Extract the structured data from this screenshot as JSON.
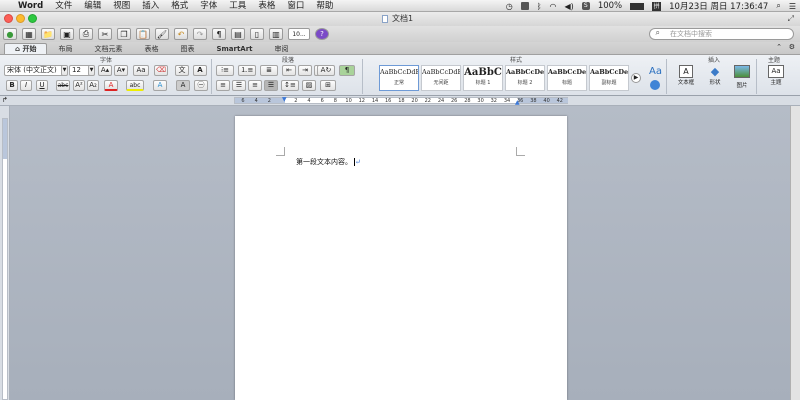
{
  "menubar": {
    "apple": "",
    "app": "Word",
    "items": [
      "文件",
      "编辑",
      "视图",
      "插入",
      "格式",
      "字体",
      "工具",
      "表格",
      "窗口",
      "帮助"
    ],
    "battery": "100%",
    "datetime": "10月23日 周日 17:36:47"
  },
  "window": {
    "title": "文档1"
  },
  "toolbar": {
    "zoom": "10...",
    "search_placeholder": "在文档中搜索"
  },
  "tabs": [
    "开始",
    "布局",
    "文档元素",
    "表格",
    "图表",
    "SmartArt",
    "审阅"
  ],
  "ribbon": {
    "groups": {
      "font": "字体",
      "paragraph": "段落",
      "styles": "样式",
      "insert": "插入",
      "themes": "主题"
    },
    "font_name": "宋体 (中文正文)",
    "font_size": "12",
    "styles": [
      {
        "preview": "AaBbCcDdEe",
        "name": "正常"
      },
      {
        "preview": "AaBbCcDdEe",
        "name": "无间距"
      },
      {
        "preview": "AaBbC",
        "name": "标题 1"
      },
      {
        "preview": "AaBbCcDe",
        "name": "标题 2"
      },
      {
        "preview": "AaBbCcDe",
        "name": "标题"
      },
      {
        "preview": "AaBbCcDe",
        "name": "副标题"
      }
    ],
    "insert_items": [
      "文本框",
      "形状",
      "图片"
    ],
    "theme_label": "主题"
  },
  "ruler": {
    "ticks": [
      "6",
      "4",
      "2",
      "",
      "2",
      "4",
      "6",
      "8",
      "10",
      "12",
      "14",
      "16",
      "18",
      "20",
      "22",
      "24",
      "26",
      "28",
      "30",
      "32",
      "34",
      "36",
      "38",
      "40",
      "42"
    ]
  },
  "document": {
    "text": "第一段文本内容。"
  },
  "colors": {
    "accent": "#3b78d8",
    "canvas": "#a9b1bd",
    "ribbon": "#e6e9ee"
  }
}
